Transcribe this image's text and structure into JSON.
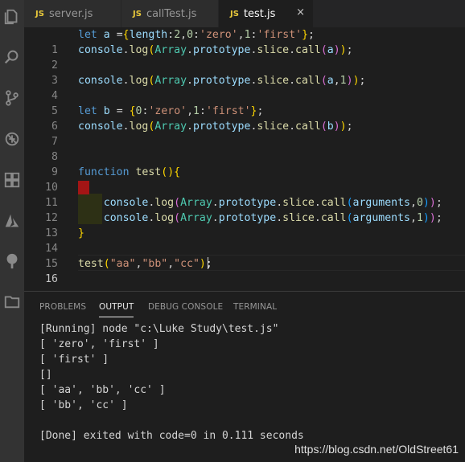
{
  "tabs": [
    {
      "icon": "JS",
      "label": "server.js"
    },
    {
      "icon": "JS",
      "label": "callTest.js"
    },
    {
      "icon": "JS",
      "label": "test.js",
      "close": "×"
    }
  ],
  "editor": {
    "line_numbers": [
      "1",
      "2",
      "3",
      "4",
      "5",
      "6",
      "7",
      "8",
      "9",
      "10",
      "11",
      "12",
      "13",
      "14",
      "15",
      "16"
    ],
    "lines": [
      "let a ={length:2,0:'zero',1:'first'};",
      "console.log(Array.prototype.slice.call(a));",
      "",
      "console.log(Array.prototype.slice.call(a,1));",
      "",
      "let b = {0:'zero',1:'first'};",
      "console.log(Array.prototype.slice.call(b));",
      "",
      "",
      "function test(){",
      "",
      "    console.log(Array.prototype.slice.call(arguments,0));",
      "    console.log(Array.prototype.slice.call(arguments,1));",
      "}",
      "",
      "test(\"aa\",\"bb\",\"cc\");"
    ]
  },
  "panel": {
    "tabs": [
      "PROBLEMS",
      "OUTPUT",
      "DEBUG CONSOLE",
      "TERMINAL"
    ],
    "output": [
      "[Running] node \"c:\\Luke Study\\test.js\"",
      "[ 'zero', 'first' ]",
      "[ 'first' ]",
      "[]",
      "[ 'aa', 'bb', 'cc' ]",
      "[ 'bb', 'cc' ]",
      "",
      "[Done] exited with code=0 in 0.111 seconds"
    ]
  },
  "watermark": "https://blog.csdn.net/OldStreet61",
  "colors": {
    "keyword": "#569cd6",
    "function": "#dcdcaa",
    "string": "#ce9178",
    "param": "#9cdcfe",
    "type": "#4ec9b0",
    "number": "#b5cea8"
  }
}
